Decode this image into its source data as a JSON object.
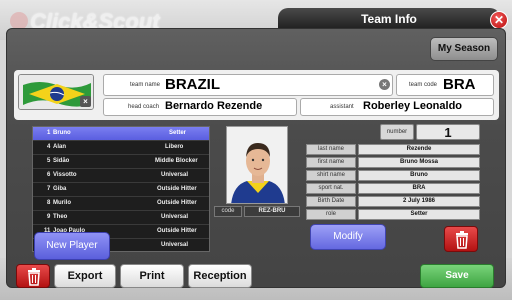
{
  "app": {
    "logo_text": "Click&Scout"
  },
  "window": {
    "title": "Team Info",
    "close_glyph": "✕"
  },
  "season_button": "My Season",
  "team": {
    "name_label": "team name",
    "name": "BRAZIL",
    "code_label": "team code",
    "code": "BRA",
    "coach_label": "head coach",
    "coach": "Bernardo Rezende",
    "assistant_label": "assistant",
    "assistant": "Roberley Leonaldo",
    "flag_icon": "brazil-flag"
  },
  "players": [
    {
      "num": "1",
      "name": "Bruno",
      "role": "Setter",
      "selected": true
    },
    {
      "num": "4",
      "name": "Alan",
      "role": "Libero"
    },
    {
      "num": "5",
      "name": "Sidão",
      "role": "Middle Blocker"
    },
    {
      "num": "6",
      "name": "Vissotto",
      "role": "Universal"
    },
    {
      "num": "7",
      "name": "Giba",
      "role": "Outside Hitter"
    },
    {
      "num": "8",
      "name": "Murilo",
      "role": "Outside Hitter"
    },
    {
      "num": "9",
      "name": "Theo",
      "role": "Universal"
    },
    {
      "num": "11",
      "name": "Joao Paulo",
      "role": "Outside Hitter"
    },
    {
      "num": "",
      "name": "",
      "role": "Universal"
    }
  ],
  "new_player_button": "New Player",
  "selected_player": {
    "code_label": "code",
    "code": "REZ-BRU",
    "number_label": "number",
    "number": "1",
    "details": [
      {
        "label": "last name",
        "value": "Rezende"
      },
      {
        "label": "first name",
        "value": "Bruno Mossa"
      },
      {
        "label": "shirt name",
        "value": "Bruno"
      },
      {
        "label": "sport nat.",
        "value": "BRA"
      },
      {
        "label": "Birth Date",
        "value": "2 July 1986"
      },
      {
        "label": "role",
        "value": "Setter"
      }
    ]
  },
  "modify_button": "Modify",
  "bottom_bar": {
    "export": "Export",
    "print": "Print",
    "reception": "Reception",
    "save": "Save"
  },
  "colors": {
    "accent": "#6468e0",
    "danger": "#c21a1a",
    "save": "#4db152"
  }
}
